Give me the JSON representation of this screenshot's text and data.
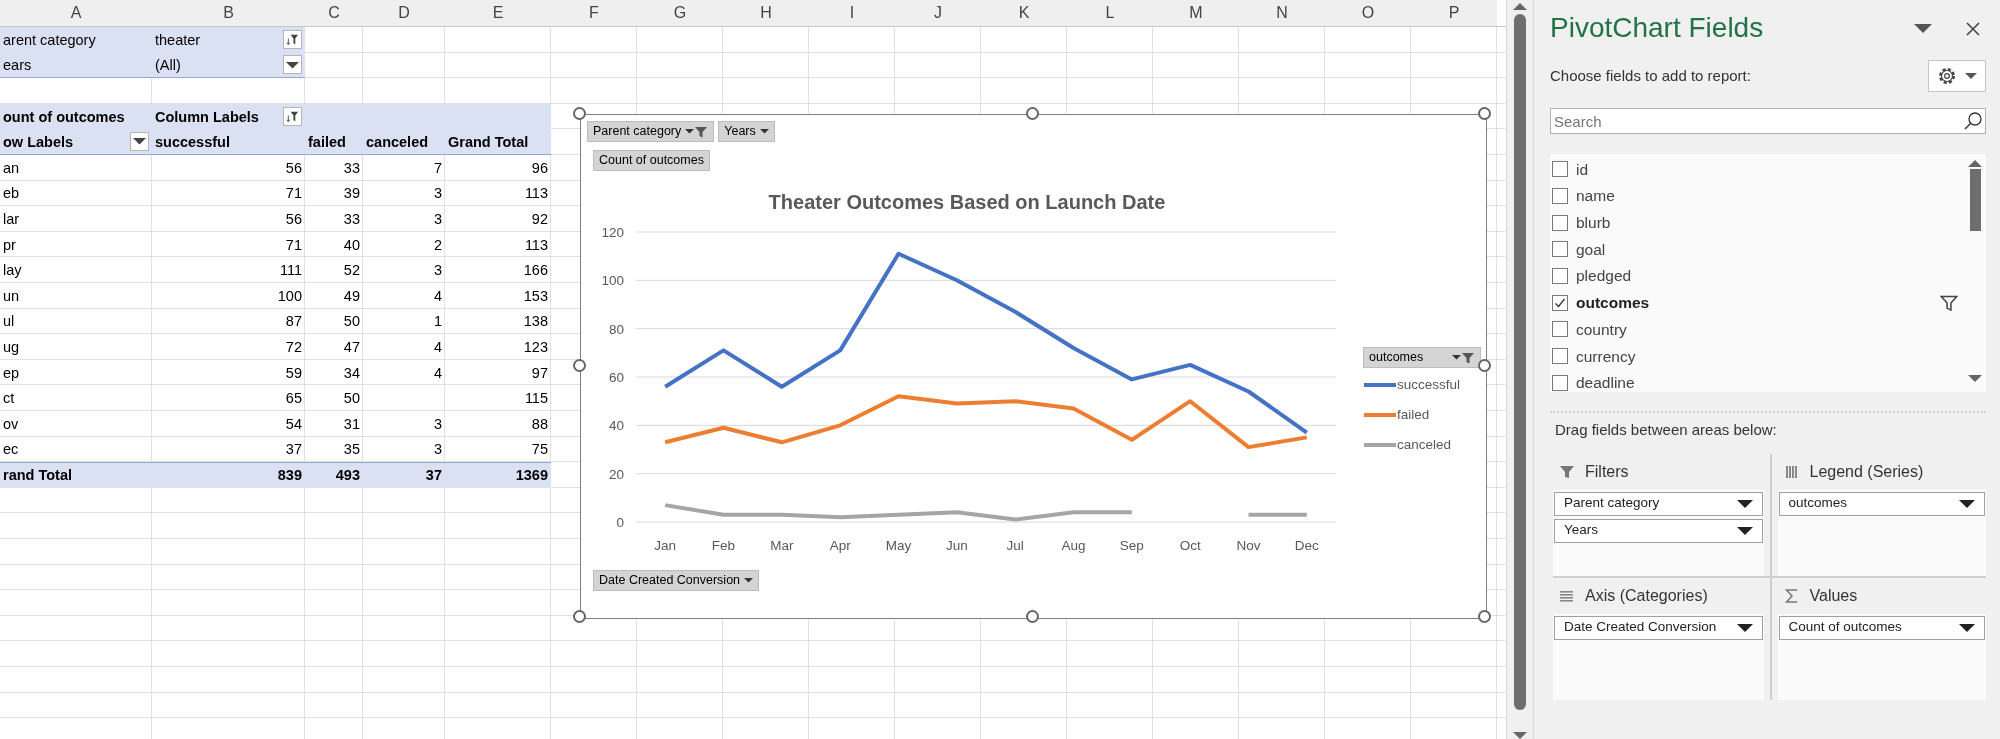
{
  "sheet": {
    "column_headers": [
      "A",
      "B",
      "C",
      "D",
      "E",
      "F",
      "G",
      "H",
      "I",
      "J",
      "K",
      "L",
      "M",
      "N",
      "O",
      "P"
    ],
    "pivot": {
      "filters": [
        {
          "label": "arent category",
          "value": "theater",
          "filtered": true
        },
        {
          "label": "ears",
          "value": "(All)",
          "filtered": false
        }
      ],
      "values_label": "ount of outcomes",
      "column_labels": {
        "label": "Column Labels",
        "filtered": true
      },
      "row_labels": {
        "label": "ow Labels",
        "filtered": false
      },
      "columns": [
        "successful",
        "failed",
        "canceled",
        "Grand Total"
      ],
      "rows": [
        {
          "label": "an",
          "successful": "56",
          "failed": "33",
          "canceled": "7",
          "grand_total": "96"
        },
        {
          "label": "eb",
          "successful": "71",
          "failed": "39",
          "canceled": "3",
          "grand_total": "113"
        },
        {
          "label": "lar",
          "successful": "56",
          "failed": "33",
          "canceled": "3",
          "grand_total": "92"
        },
        {
          "label": "pr",
          "successful": "71",
          "failed": "40",
          "canceled": "2",
          "grand_total": "113"
        },
        {
          "label": "lay",
          "successful": "111",
          "failed": "52",
          "canceled": "3",
          "grand_total": "166"
        },
        {
          "label": "un",
          "successful": "100",
          "failed": "49",
          "canceled": "4",
          "grand_total": "153"
        },
        {
          "label": "ul",
          "successful": "87",
          "failed": "50",
          "canceled": "1",
          "grand_total": "138"
        },
        {
          "label": "ug",
          "successful": "72",
          "failed": "47",
          "canceled": "4",
          "grand_total": "123"
        },
        {
          "label": "ep",
          "successful": "59",
          "failed": "34",
          "canceled": "4",
          "grand_total": "97"
        },
        {
          "label": "ct",
          "successful": "65",
          "failed": "50",
          "grand_total": "115"
        },
        {
          "label": "ov",
          "successful": "54",
          "failed": "31",
          "canceled": "3",
          "grand_total": "88"
        },
        {
          "label": "ec",
          "successful": "37",
          "failed": "35",
          "canceled": "3",
          "grand_total": "75"
        }
      ],
      "grand_total": {
        "label": "rand Total",
        "successful": "839",
        "failed": "493",
        "canceled": "37",
        "grand_total": "1369"
      }
    }
  },
  "chart": {
    "filter_buttons": [
      {
        "label": "Parent category",
        "filtered": true
      },
      {
        "label": "Years",
        "filtered": false
      }
    ],
    "value_button": "Count of outcomes",
    "axis_button": "Date Created Conversion",
    "legend_button": {
      "label": "outcomes",
      "filtered": true
    },
    "chart_data": {
      "type": "line",
      "title": "Theater Outcomes Based on Launch Date",
      "categories": [
        "Jan",
        "Feb",
        "Mar",
        "Apr",
        "May",
        "Jun",
        "Jul",
        "Aug",
        "Sep",
        "Oct",
        "Nov",
        "Dec"
      ],
      "series": [
        {
          "name": "successful",
          "color": "#4472c4",
          "values": [
            56,
            71,
            56,
            71,
            111,
            100,
            87,
            72,
            59,
            65,
            54,
            37
          ]
        },
        {
          "name": "failed",
          "color": "#ed7d31",
          "values": [
            33,
            39,
            33,
            40,
            52,
            49,
            50,
            47,
            34,
            50,
            31,
            35
          ]
        },
        {
          "name": "canceled",
          "color": "#a5a5a5",
          "values": [
            7,
            3,
            3,
            2,
            3,
            4,
            1,
            4,
            4,
            null,
            3,
            3
          ]
        }
      ],
      "ylim": [
        0,
        120
      ],
      "grid": true,
      "yticks": [
        0,
        20,
        40,
        60,
        80,
        100,
        120
      ]
    }
  },
  "field_panel": {
    "title": "PivotChart Fields",
    "subtitle": "Choose fields to add to report:",
    "search": {
      "placeholder": "Search"
    },
    "fields": [
      {
        "label": "id",
        "checked": false,
        "filtered": false
      },
      {
        "label": "name",
        "checked": false,
        "filtered": false
      },
      {
        "label": "blurb",
        "checked": false,
        "filtered": false
      },
      {
        "label": "goal",
        "checked": false,
        "filtered": false
      },
      {
        "label": "pledged",
        "checked": false,
        "filtered": false
      },
      {
        "label": "outcomes",
        "checked": true,
        "filtered": true
      },
      {
        "label": "country",
        "checked": false,
        "filtered": false
      },
      {
        "label": "currency",
        "checked": false,
        "filtered": false
      },
      {
        "label": "deadline",
        "checked": false,
        "filtered": false
      }
    ],
    "areas_hint": "Drag fields between areas below:",
    "areas": [
      {
        "kind": "filters",
        "title": "Filters",
        "fields": [
          "Parent category",
          "Years"
        ]
      },
      {
        "kind": "legend",
        "title": "Legend (Series)",
        "fields": [
          "outcomes"
        ]
      },
      {
        "kind": "axis",
        "title": "Axis (Categories)",
        "fields": [
          "Date Created Conversion"
        ]
      },
      {
        "kind": "values",
        "title": "Values",
        "fields": [
          "Count of outcomes"
        ]
      }
    ]
  }
}
